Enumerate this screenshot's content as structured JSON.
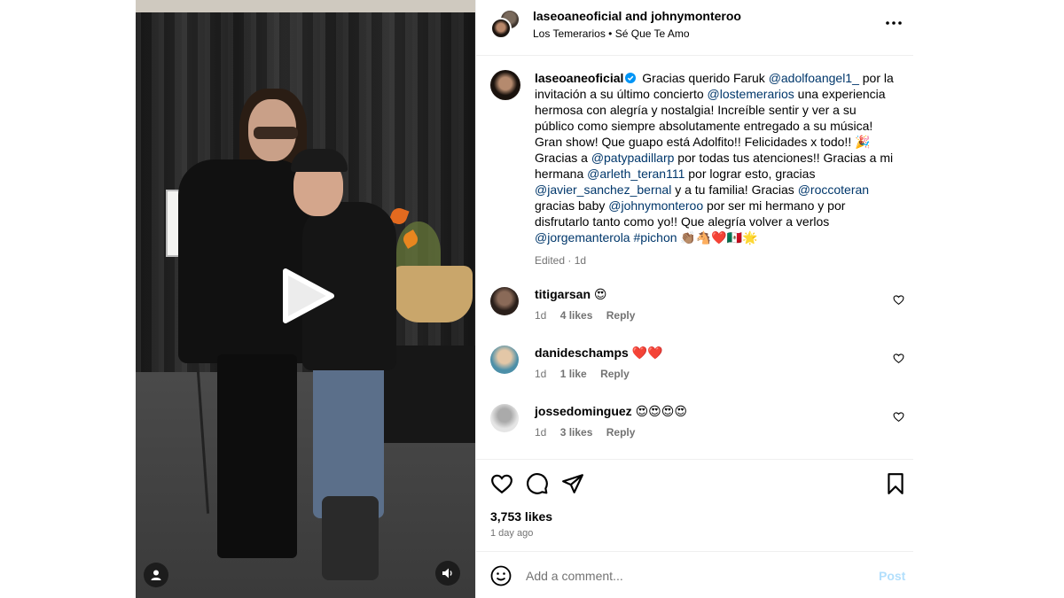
{
  "post": {
    "authors": "laseoaneoficial",
    "and_text": "and",
    "coauthor": "johnymonteroo",
    "audio_artist": "Los Temerarios",
    "audio_separator": "•",
    "audio_track": "Sé Que Te Amo"
  },
  "caption": {
    "username": "laseoaneoficial",
    "t1": "Gracias querido Faruk ",
    "m1": "@adolfoangel1_",
    "t2": " por la invitación a su último concierto ",
    "m2": "@lostemerarios",
    "t3": " una experiencia hermosa con alegría y nostalgia! Increíble sentir y ver a su público como siempre absolutamente entregado a su música! Gran show! Que guapo está Adolfito!! Felicidades x todo!! 🎉Gracias a ",
    "m3": "@patypadillarp",
    "t4": " por todas tus atenciones!! Gracias a mi hermana ",
    "m4": "@arleth_teran111",
    "t5": " por lograr esto, gracias ",
    "m5": "@javier_sanchez_bernal",
    "t6": " y a tu familia! Gracias ",
    "m6": "@roccoteran",
    "t7": " gracias baby ",
    "m7": "@johnymonteroo",
    "t8": " por ser mi hermano y por disfrutarlo tanto como yo!! Que alegría volver a verlos ",
    "m8": "@jorgemanterola",
    "t9": " ",
    "m9": "#pichon",
    "t10": " 👏🏽🐴❤️🇲🇽🌟",
    "edited": "Edited",
    "edited_sep": "·",
    "edited_time": "1d"
  },
  "comments": [
    {
      "username": "titigarsan",
      "text": "😍",
      "time": "1d",
      "likes": "4 likes",
      "reply": "Reply"
    },
    {
      "username": "danideschamps",
      "text": "❤️❤️",
      "time": "1d",
      "likes": "1 like",
      "reply": "Reply"
    },
    {
      "username": "jossedominguez",
      "text": "😍😍😍😍",
      "time": "1d",
      "likes": "3 likes",
      "reply": "Reply"
    }
  ],
  "actions": {
    "likes": "3,753 likes",
    "time": "1 day ago"
  },
  "composer": {
    "placeholder": "Add a comment...",
    "post_label": "Post"
  },
  "colors": {
    "link": "#00376b",
    "muted": "#737373",
    "post_disabled": "#b2dffc",
    "verified": "#0095f6"
  },
  "icons": {
    "play": "play-icon",
    "account": "user-icon",
    "audio": "speaker-icon",
    "more": "more-icon",
    "verified": "verified-icon",
    "heart": "heart-icon",
    "comment": "comment-icon",
    "share": "share-icon",
    "save": "bookmark-icon",
    "emoji": "emoji-icon"
  }
}
